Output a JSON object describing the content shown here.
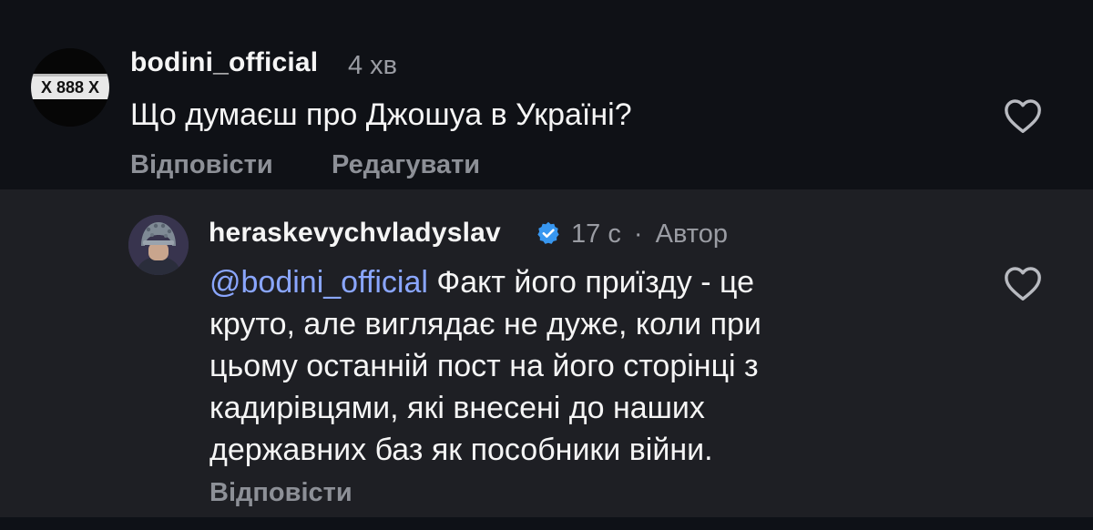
{
  "comment": {
    "username": "bodini_official",
    "time": "4 хв",
    "text": "Що думаєш про Джошуа в Україні?",
    "reply_label": "Відповісти",
    "edit_label": "Редагувати",
    "avatar_plate": "X 888 X",
    "like_icon": "heart-outline-icon"
  },
  "reply": {
    "username": "heraskevychvladyslav",
    "verified_icon": "verified-badge-icon",
    "time": "17 с",
    "separator": "·",
    "author_label": "Автор",
    "mention": "@bodini_official",
    "text_lines": [
      " Факт його приїзду - це",
      "круто, але виглядає не дуже, коли при",
      "цьому останній пост на його сторінці з",
      "кадирівцями, які внесені до наших",
      "державних баз як пособники війни."
    ],
    "reply_label": "Відповісти",
    "like_icon": "heart-outline-icon"
  },
  "colors": {
    "background": "#0f1116",
    "reply_background": "#1e1f24",
    "mention": "#8aa6ff",
    "verified": "#3897f0",
    "muted": "#9a9ca3"
  }
}
